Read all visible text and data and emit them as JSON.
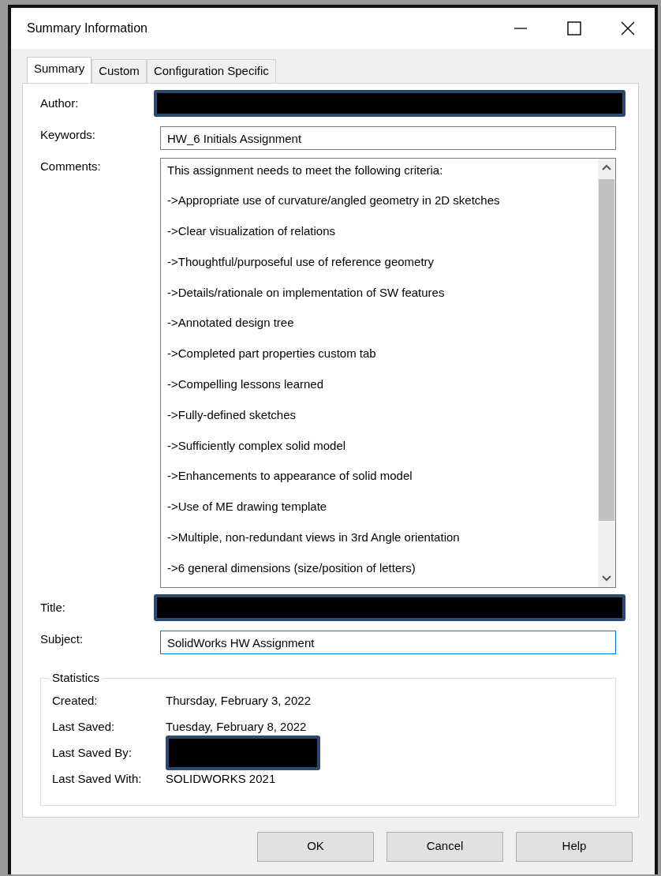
{
  "window": {
    "title": "Summary Information"
  },
  "tabs": [
    {
      "label": "Summary",
      "selected": true
    },
    {
      "label": "Custom",
      "selected": false
    },
    {
      "label": "Configuration Specific",
      "selected": false
    }
  ],
  "fields": [
    {
      "label": "Author:",
      "kind": "redacted"
    },
    {
      "label": "Keywords:",
      "value": "HW_6 Initials Assignment",
      "kind": "text"
    }
  ],
  "comments": {
    "label": "Comments:",
    "lines": [
      "This assignment needs to meet the following criteria:",
      "->Appropriate use of curvature/angled geometry in 2D sketches",
      "->Clear visualization of relations",
      "->Thoughtful/purposeful use of reference geometry",
      "->Details/rationale on implementation of SW features",
      "->Annotated design tree",
      "->Completed part properties custom tab",
      "->Compelling lessons learned",
      "->Fully-defined sketches",
      "->Sufficiently complex solid model",
      "->Enhancements to appearance of solid model",
      "->Use of ME drawing template",
      "->Multiple, non-redundant views in 3rd Angle orientation",
      "->6 general dimensions (size/position of letters)"
    ]
  },
  "fields2": [
    {
      "label": "Title:",
      "kind": "redacted"
    },
    {
      "label": "Subject:",
      "value": "SolidWorks HW Assignment",
      "kind": "text",
      "focused": true
    }
  ],
  "statistics": {
    "title": "Statistics",
    "rows": [
      {
        "label": "Created:",
        "value": "Thursday, February 3, 2022",
        "kind": "text"
      },
      {
        "label": "Last Saved:",
        "value": "Tuesday, February 8, 2022",
        "kind": "text"
      },
      {
        "label": "Last Saved By:",
        "kind": "redacted"
      },
      {
        "label": "Last Saved With:",
        "value": "SOLIDWORKS 2021",
        "kind": "text"
      }
    ]
  },
  "buttons": [
    "OK",
    "Cancel",
    "Help"
  ]
}
